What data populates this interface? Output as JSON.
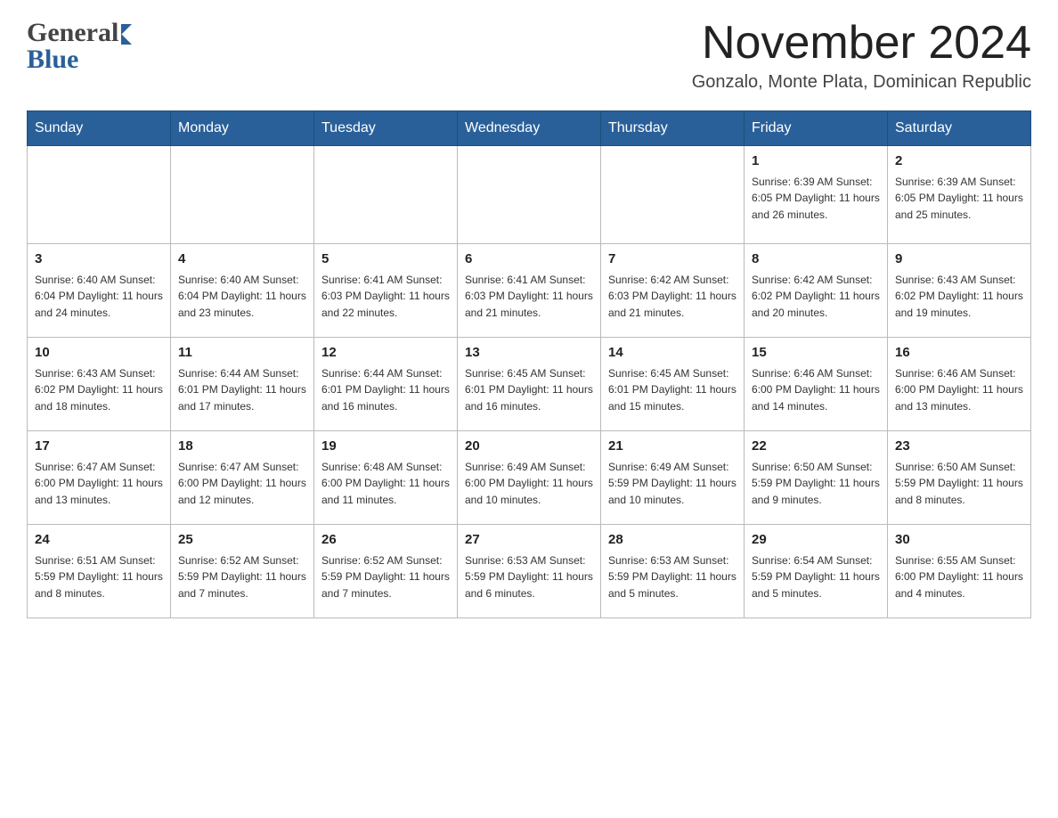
{
  "header": {
    "logo_general": "General",
    "logo_blue": "Blue",
    "month_title": "November 2024",
    "location": "Gonzalo, Monte Plata, Dominican Republic"
  },
  "weekdays": [
    "Sunday",
    "Monday",
    "Tuesday",
    "Wednesday",
    "Thursday",
    "Friday",
    "Saturday"
  ],
  "weeks": [
    [
      {
        "day": "",
        "info": ""
      },
      {
        "day": "",
        "info": ""
      },
      {
        "day": "",
        "info": ""
      },
      {
        "day": "",
        "info": ""
      },
      {
        "day": "",
        "info": ""
      },
      {
        "day": "1",
        "info": "Sunrise: 6:39 AM\nSunset: 6:05 PM\nDaylight: 11 hours and 26 minutes."
      },
      {
        "day": "2",
        "info": "Sunrise: 6:39 AM\nSunset: 6:05 PM\nDaylight: 11 hours and 25 minutes."
      }
    ],
    [
      {
        "day": "3",
        "info": "Sunrise: 6:40 AM\nSunset: 6:04 PM\nDaylight: 11 hours and 24 minutes."
      },
      {
        "day": "4",
        "info": "Sunrise: 6:40 AM\nSunset: 6:04 PM\nDaylight: 11 hours and 23 minutes."
      },
      {
        "day": "5",
        "info": "Sunrise: 6:41 AM\nSunset: 6:03 PM\nDaylight: 11 hours and 22 minutes."
      },
      {
        "day": "6",
        "info": "Sunrise: 6:41 AM\nSunset: 6:03 PM\nDaylight: 11 hours and 21 minutes."
      },
      {
        "day": "7",
        "info": "Sunrise: 6:42 AM\nSunset: 6:03 PM\nDaylight: 11 hours and 21 minutes."
      },
      {
        "day": "8",
        "info": "Sunrise: 6:42 AM\nSunset: 6:02 PM\nDaylight: 11 hours and 20 minutes."
      },
      {
        "day": "9",
        "info": "Sunrise: 6:43 AM\nSunset: 6:02 PM\nDaylight: 11 hours and 19 minutes."
      }
    ],
    [
      {
        "day": "10",
        "info": "Sunrise: 6:43 AM\nSunset: 6:02 PM\nDaylight: 11 hours and 18 minutes."
      },
      {
        "day": "11",
        "info": "Sunrise: 6:44 AM\nSunset: 6:01 PM\nDaylight: 11 hours and 17 minutes."
      },
      {
        "day": "12",
        "info": "Sunrise: 6:44 AM\nSunset: 6:01 PM\nDaylight: 11 hours and 16 minutes."
      },
      {
        "day": "13",
        "info": "Sunrise: 6:45 AM\nSunset: 6:01 PM\nDaylight: 11 hours and 16 minutes."
      },
      {
        "day": "14",
        "info": "Sunrise: 6:45 AM\nSunset: 6:01 PM\nDaylight: 11 hours and 15 minutes."
      },
      {
        "day": "15",
        "info": "Sunrise: 6:46 AM\nSunset: 6:00 PM\nDaylight: 11 hours and 14 minutes."
      },
      {
        "day": "16",
        "info": "Sunrise: 6:46 AM\nSunset: 6:00 PM\nDaylight: 11 hours and 13 minutes."
      }
    ],
    [
      {
        "day": "17",
        "info": "Sunrise: 6:47 AM\nSunset: 6:00 PM\nDaylight: 11 hours and 13 minutes."
      },
      {
        "day": "18",
        "info": "Sunrise: 6:47 AM\nSunset: 6:00 PM\nDaylight: 11 hours and 12 minutes."
      },
      {
        "day": "19",
        "info": "Sunrise: 6:48 AM\nSunset: 6:00 PM\nDaylight: 11 hours and 11 minutes."
      },
      {
        "day": "20",
        "info": "Sunrise: 6:49 AM\nSunset: 6:00 PM\nDaylight: 11 hours and 10 minutes."
      },
      {
        "day": "21",
        "info": "Sunrise: 6:49 AM\nSunset: 5:59 PM\nDaylight: 11 hours and 10 minutes."
      },
      {
        "day": "22",
        "info": "Sunrise: 6:50 AM\nSunset: 5:59 PM\nDaylight: 11 hours and 9 minutes."
      },
      {
        "day": "23",
        "info": "Sunrise: 6:50 AM\nSunset: 5:59 PM\nDaylight: 11 hours and 8 minutes."
      }
    ],
    [
      {
        "day": "24",
        "info": "Sunrise: 6:51 AM\nSunset: 5:59 PM\nDaylight: 11 hours and 8 minutes."
      },
      {
        "day": "25",
        "info": "Sunrise: 6:52 AM\nSunset: 5:59 PM\nDaylight: 11 hours and 7 minutes."
      },
      {
        "day": "26",
        "info": "Sunrise: 6:52 AM\nSunset: 5:59 PM\nDaylight: 11 hours and 7 minutes."
      },
      {
        "day": "27",
        "info": "Sunrise: 6:53 AM\nSunset: 5:59 PM\nDaylight: 11 hours and 6 minutes."
      },
      {
        "day": "28",
        "info": "Sunrise: 6:53 AM\nSunset: 5:59 PM\nDaylight: 11 hours and 5 minutes."
      },
      {
        "day": "29",
        "info": "Sunrise: 6:54 AM\nSunset: 5:59 PM\nDaylight: 11 hours and 5 minutes."
      },
      {
        "day": "30",
        "info": "Sunrise: 6:55 AM\nSunset: 6:00 PM\nDaylight: 11 hours and 4 minutes."
      }
    ]
  ]
}
